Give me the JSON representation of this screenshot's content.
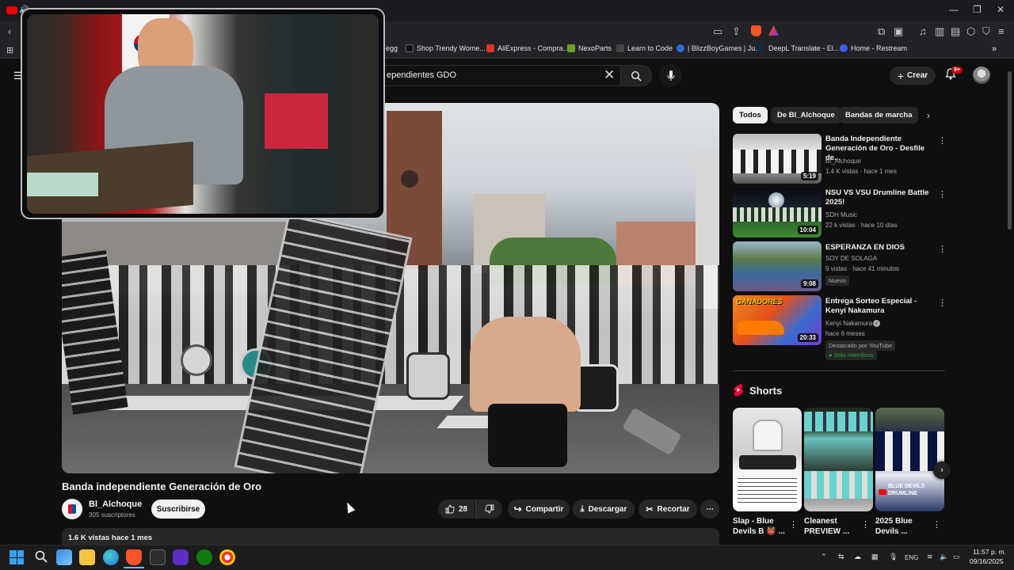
{
  "browser": {
    "window_controls": [
      "—",
      "❐",
      "✕"
    ],
    "bookmarks": [
      {
        "label": "egg",
        "color": "#3a3a3a"
      },
      {
        "label": "Shop Trendy Wome...",
        "color": "#1a1a1a"
      },
      {
        "label": "AliExpress - Compra...",
        "color": "#e43225"
      },
      {
        "label": "NexoParts",
        "color": "#6ca12a"
      },
      {
        "label": "Learn to Code",
        "color": "#444"
      },
      {
        "label": "| BlizzBoyGames | Ju...",
        "color": "#2a6bd6"
      },
      {
        "label": "DeepL Translate - El...",
        "color": "#0f2b46"
      },
      {
        "label": "Home - Restream",
        "color": "#3c5cf0"
      }
    ],
    "bookmarks_more": "»"
  },
  "header": {
    "search_value": "ependientes GDO",
    "create_label": "Crear",
    "notification_count": "9+"
  },
  "video": {
    "title": "Banda independiente Generación de Oro",
    "channel": "Bl_Alchoque",
    "subscribers": "305 suscriptores",
    "subscribe_label": "Suscribirse",
    "likes": "28",
    "share_label": "Compartir",
    "download_label": "Descargar",
    "clip_label": "Recortar",
    "views_date": "1.6 K vistas  hace 1 mes"
  },
  "chips": [
    "Todos",
    "De Bl_Alchoque",
    "Bandas de marcha"
  ],
  "recommended": [
    {
      "title": "Banda Independiente Generación de Oro - Desfile de...",
      "channel": "Bl_Alchoque",
      "meta": "1.4 K vistas · hace 1 mes",
      "duration": "5:19"
    },
    {
      "title": "NSU VS VSU Drumline Battle 2025!",
      "channel": "SDH Music",
      "meta": "22 k vistas · hace 10 días",
      "duration": "10:04"
    },
    {
      "title": "ESPERANZA EN DIOS",
      "channel": "SOY DE SOLAGA",
      "meta": "9 vistas · hace 41 minutos",
      "duration": "9:08",
      "badge": "Nuevo"
    },
    {
      "title": "Entrega Sorteo Especial - Kenyi Nakamura",
      "channel": "Kenyi Nakamura",
      "meta": "hace 6 meses",
      "duration": "20:33",
      "badge": "Destacado por YouTube",
      "badge2": "Solo miembros",
      "thumb_text": "GANADORES"
    }
  ],
  "shorts": {
    "label": "Shorts",
    "items": [
      {
        "title": "Slap - Blue Devils B 👹 ..."
      },
      {
        "title": "Cleanest PREVIEW ..."
      },
      {
        "title": "2025 Blue Devils ...",
        "thumb_text": "BLUE DEVILS DRUMLINE"
      }
    ]
  },
  "taskbar": {
    "lang": "ENG",
    "time": "11:57 p. m.",
    "date": "09/16/2025"
  }
}
